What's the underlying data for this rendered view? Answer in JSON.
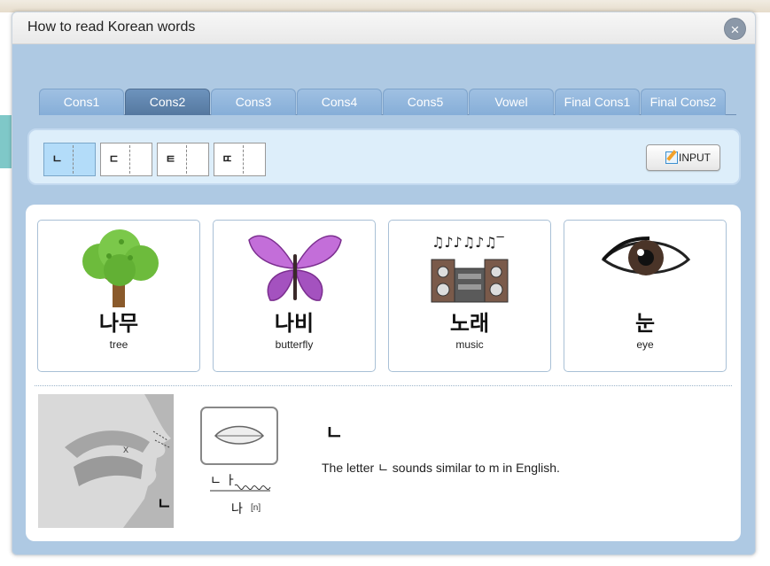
{
  "dialog": {
    "title": "How to read Korean words",
    "close_icon": "×"
  },
  "tabs": [
    {
      "label": "Cons1",
      "active": false
    },
    {
      "label": "Cons2",
      "active": true
    },
    {
      "label": "Cons3",
      "active": false
    },
    {
      "label": "Cons4",
      "active": false
    },
    {
      "label": "Cons5",
      "active": false
    },
    {
      "label": "Vowel",
      "active": false
    },
    {
      "label": "Final Cons1",
      "active": false
    },
    {
      "label": "Final Cons2",
      "active": false
    }
  ],
  "letters": [
    {
      "glyph": "ㄴ",
      "selected": true
    },
    {
      "glyph": "ㄷ",
      "selected": false
    },
    {
      "glyph": "ㅌ",
      "selected": false
    },
    {
      "glyph": "ㄸ",
      "selected": false
    }
  ],
  "input_button": {
    "label": "INPUT",
    "icon": "pen-icon"
  },
  "cards": [
    {
      "word": "나무",
      "meaning": "tree",
      "icon": "tree-icon"
    },
    {
      "word": "나비",
      "meaning": "butterfly",
      "icon": "butterfly-icon"
    },
    {
      "word": "노래",
      "meaning": "music",
      "icon": "music-icon"
    },
    {
      "word": "눈",
      "meaning": "eye",
      "icon": "eye-icon"
    }
  ],
  "pronunciation": {
    "diagram_letter": "ㄴ",
    "syllable_jamo": "ㄴ ㅏ",
    "syllable": "나",
    "phonetic": "[n]",
    "letter": "ㄴ",
    "description": "The letter ㄴ sounds similar to m in English."
  },
  "colors": {
    "dialog_bg": "#aec9e3",
    "tab_active": "#55789f",
    "tab_inactive": "#86aed8",
    "selected_letter": "#b3dcf9"
  }
}
